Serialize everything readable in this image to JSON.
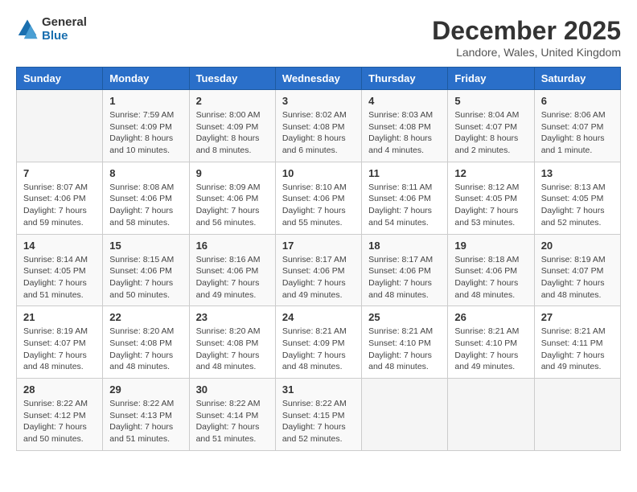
{
  "header": {
    "logo_general": "General",
    "logo_blue": "Blue",
    "month_title": "December 2025",
    "location": "Landore, Wales, United Kingdom"
  },
  "weekdays": [
    "Sunday",
    "Monday",
    "Tuesday",
    "Wednesday",
    "Thursday",
    "Friday",
    "Saturday"
  ],
  "weeks": [
    [
      {
        "day": "",
        "info": ""
      },
      {
        "day": "1",
        "info": "Sunrise: 7:59 AM\nSunset: 4:09 PM\nDaylight: 8 hours\nand 10 minutes."
      },
      {
        "day": "2",
        "info": "Sunrise: 8:00 AM\nSunset: 4:09 PM\nDaylight: 8 hours\nand 8 minutes."
      },
      {
        "day": "3",
        "info": "Sunrise: 8:02 AM\nSunset: 4:08 PM\nDaylight: 8 hours\nand 6 minutes."
      },
      {
        "day": "4",
        "info": "Sunrise: 8:03 AM\nSunset: 4:08 PM\nDaylight: 8 hours\nand 4 minutes."
      },
      {
        "day": "5",
        "info": "Sunrise: 8:04 AM\nSunset: 4:07 PM\nDaylight: 8 hours\nand 2 minutes."
      },
      {
        "day": "6",
        "info": "Sunrise: 8:06 AM\nSunset: 4:07 PM\nDaylight: 8 hours\nand 1 minute."
      }
    ],
    [
      {
        "day": "7",
        "info": "Sunrise: 8:07 AM\nSunset: 4:06 PM\nDaylight: 7 hours\nand 59 minutes."
      },
      {
        "day": "8",
        "info": "Sunrise: 8:08 AM\nSunset: 4:06 PM\nDaylight: 7 hours\nand 58 minutes."
      },
      {
        "day": "9",
        "info": "Sunrise: 8:09 AM\nSunset: 4:06 PM\nDaylight: 7 hours\nand 56 minutes."
      },
      {
        "day": "10",
        "info": "Sunrise: 8:10 AM\nSunset: 4:06 PM\nDaylight: 7 hours\nand 55 minutes."
      },
      {
        "day": "11",
        "info": "Sunrise: 8:11 AM\nSunset: 4:06 PM\nDaylight: 7 hours\nand 54 minutes."
      },
      {
        "day": "12",
        "info": "Sunrise: 8:12 AM\nSunset: 4:05 PM\nDaylight: 7 hours\nand 53 minutes."
      },
      {
        "day": "13",
        "info": "Sunrise: 8:13 AM\nSunset: 4:05 PM\nDaylight: 7 hours\nand 52 minutes."
      }
    ],
    [
      {
        "day": "14",
        "info": "Sunrise: 8:14 AM\nSunset: 4:05 PM\nDaylight: 7 hours\nand 51 minutes."
      },
      {
        "day": "15",
        "info": "Sunrise: 8:15 AM\nSunset: 4:06 PM\nDaylight: 7 hours\nand 50 minutes."
      },
      {
        "day": "16",
        "info": "Sunrise: 8:16 AM\nSunset: 4:06 PM\nDaylight: 7 hours\nand 49 minutes."
      },
      {
        "day": "17",
        "info": "Sunrise: 8:17 AM\nSunset: 4:06 PM\nDaylight: 7 hours\nand 49 minutes."
      },
      {
        "day": "18",
        "info": "Sunrise: 8:17 AM\nSunset: 4:06 PM\nDaylight: 7 hours\nand 48 minutes."
      },
      {
        "day": "19",
        "info": "Sunrise: 8:18 AM\nSunset: 4:06 PM\nDaylight: 7 hours\nand 48 minutes."
      },
      {
        "day": "20",
        "info": "Sunrise: 8:19 AM\nSunset: 4:07 PM\nDaylight: 7 hours\nand 48 minutes."
      }
    ],
    [
      {
        "day": "21",
        "info": "Sunrise: 8:19 AM\nSunset: 4:07 PM\nDaylight: 7 hours\nand 48 minutes."
      },
      {
        "day": "22",
        "info": "Sunrise: 8:20 AM\nSunset: 4:08 PM\nDaylight: 7 hours\nand 48 minutes."
      },
      {
        "day": "23",
        "info": "Sunrise: 8:20 AM\nSunset: 4:08 PM\nDaylight: 7 hours\nand 48 minutes."
      },
      {
        "day": "24",
        "info": "Sunrise: 8:21 AM\nSunset: 4:09 PM\nDaylight: 7 hours\nand 48 minutes."
      },
      {
        "day": "25",
        "info": "Sunrise: 8:21 AM\nSunset: 4:10 PM\nDaylight: 7 hours\nand 48 minutes."
      },
      {
        "day": "26",
        "info": "Sunrise: 8:21 AM\nSunset: 4:10 PM\nDaylight: 7 hours\nand 49 minutes."
      },
      {
        "day": "27",
        "info": "Sunrise: 8:21 AM\nSunset: 4:11 PM\nDaylight: 7 hours\nand 49 minutes."
      }
    ],
    [
      {
        "day": "28",
        "info": "Sunrise: 8:22 AM\nSunset: 4:12 PM\nDaylight: 7 hours\nand 50 minutes."
      },
      {
        "day": "29",
        "info": "Sunrise: 8:22 AM\nSunset: 4:13 PM\nDaylight: 7 hours\nand 51 minutes."
      },
      {
        "day": "30",
        "info": "Sunrise: 8:22 AM\nSunset: 4:14 PM\nDaylight: 7 hours\nand 51 minutes."
      },
      {
        "day": "31",
        "info": "Sunrise: 8:22 AM\nSunset: 4:15 PM\nDaylight: 7 hours\nand 52 minutes."
      },
      {
        "day": "",
        "info": ""
      },
      {
        "day": "",
        "info": ""
      },
      {
        "day": "",
        "info": ""
      }
    ]
  ]
}
